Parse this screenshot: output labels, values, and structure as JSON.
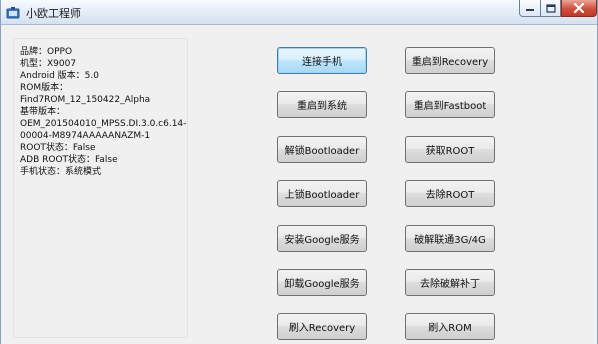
{
  "window": {
    "title": "小欧工程师",
    "controls": {
      "minimize": "minimize-icon",
      "maximize": "maximize-icon",
      "close": "close-icon"
    }
  },
  "device_info": {
    "lines": [
      "品牌：OPPO",
      "机型：X9007",
      "Android 版本：5.0",
      "ROM版本：",
      "Find7ROM_12_150422_Alpha",
      "基带版本：",
      "OEM_201504010_MPSS.DI.3.0.c6.14-",
      "00004-M8974AAAAANAZM-1",
      "ROOT状态：False",
      "ADB ROOT状态：False",
      "手机状态：系统模式"
    ]
  },
  "buttons": {
    "left": [
      "连接手机",
      "重启到系统",
      "解锁Bootloader",
      "上锁Bootloader",
      "安装Google服务",
      "卸载Google服务",
      "刷入Recovery"
    ],
    "right": [
      "重启到Recovery",
      "重启到Fastboot",
      "获取ROOT",
      "去除ROOT",
      "破解联通3G/4G",
      "去除破解补丁",
      "刷入ROM"
    ]
  }
}
